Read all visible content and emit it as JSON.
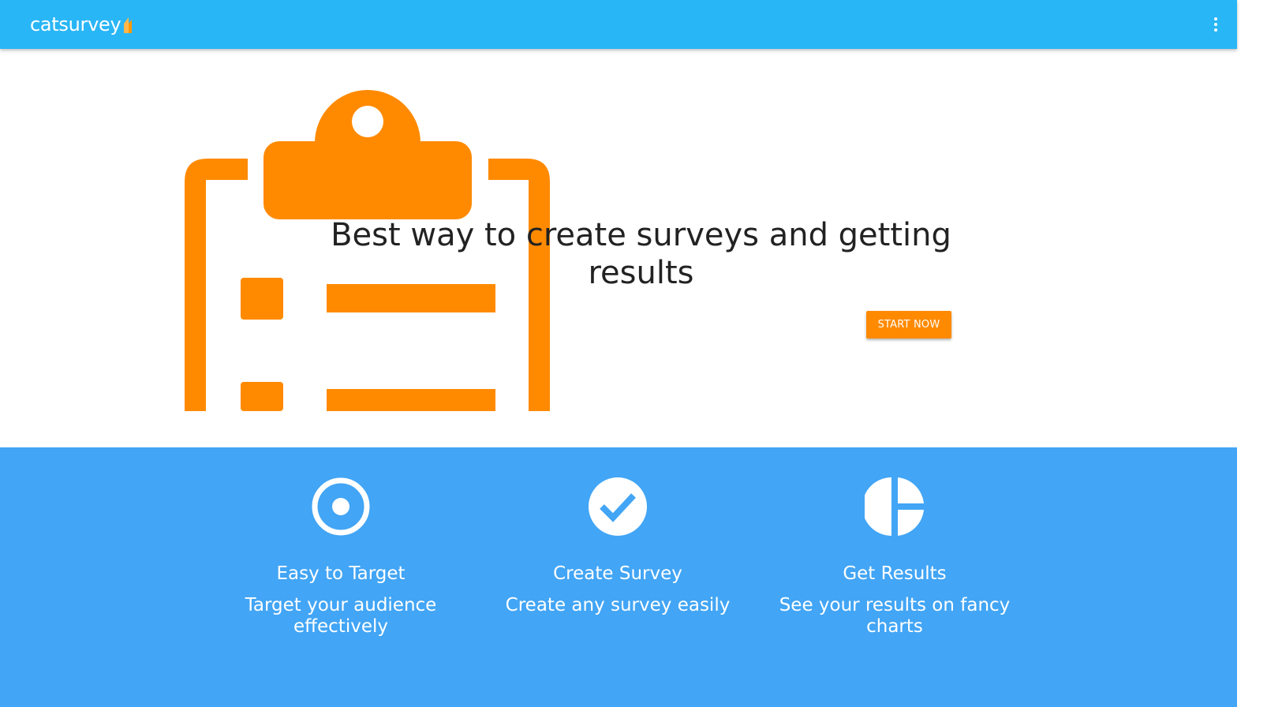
{
  "app": {
    "brand_name": "catsurvey",
    "brand_color": "#29b6f6",
    "accent_color": "#ff8a00",
    "logo_icon": "cat-ear-logo",
    "menu_icon": "more-vert-icon"
  },
  "hero": {
    "illustration_icon": "clipboard-checklist-icon",
    "title": "Best way to create surveys and getting results",
    "cta_label": "START NOW"
  },
  "features": {
    "background_color": "#42a5f5",
    "items": [
      {
        "icon": "target-icon",
        "title": "Easy to Target",
        "description": "Target your audience effectively"
      },
      {
        "icon": "check-circle-icon",
        "title": "Create Survey",
        "description": "Create any survey easily"
      },
      {
        "icon": "pie-chart-icon",
        "title": "Get Results",
        "description": "See your results on fancy charts"
      }
    ]
  }
}
